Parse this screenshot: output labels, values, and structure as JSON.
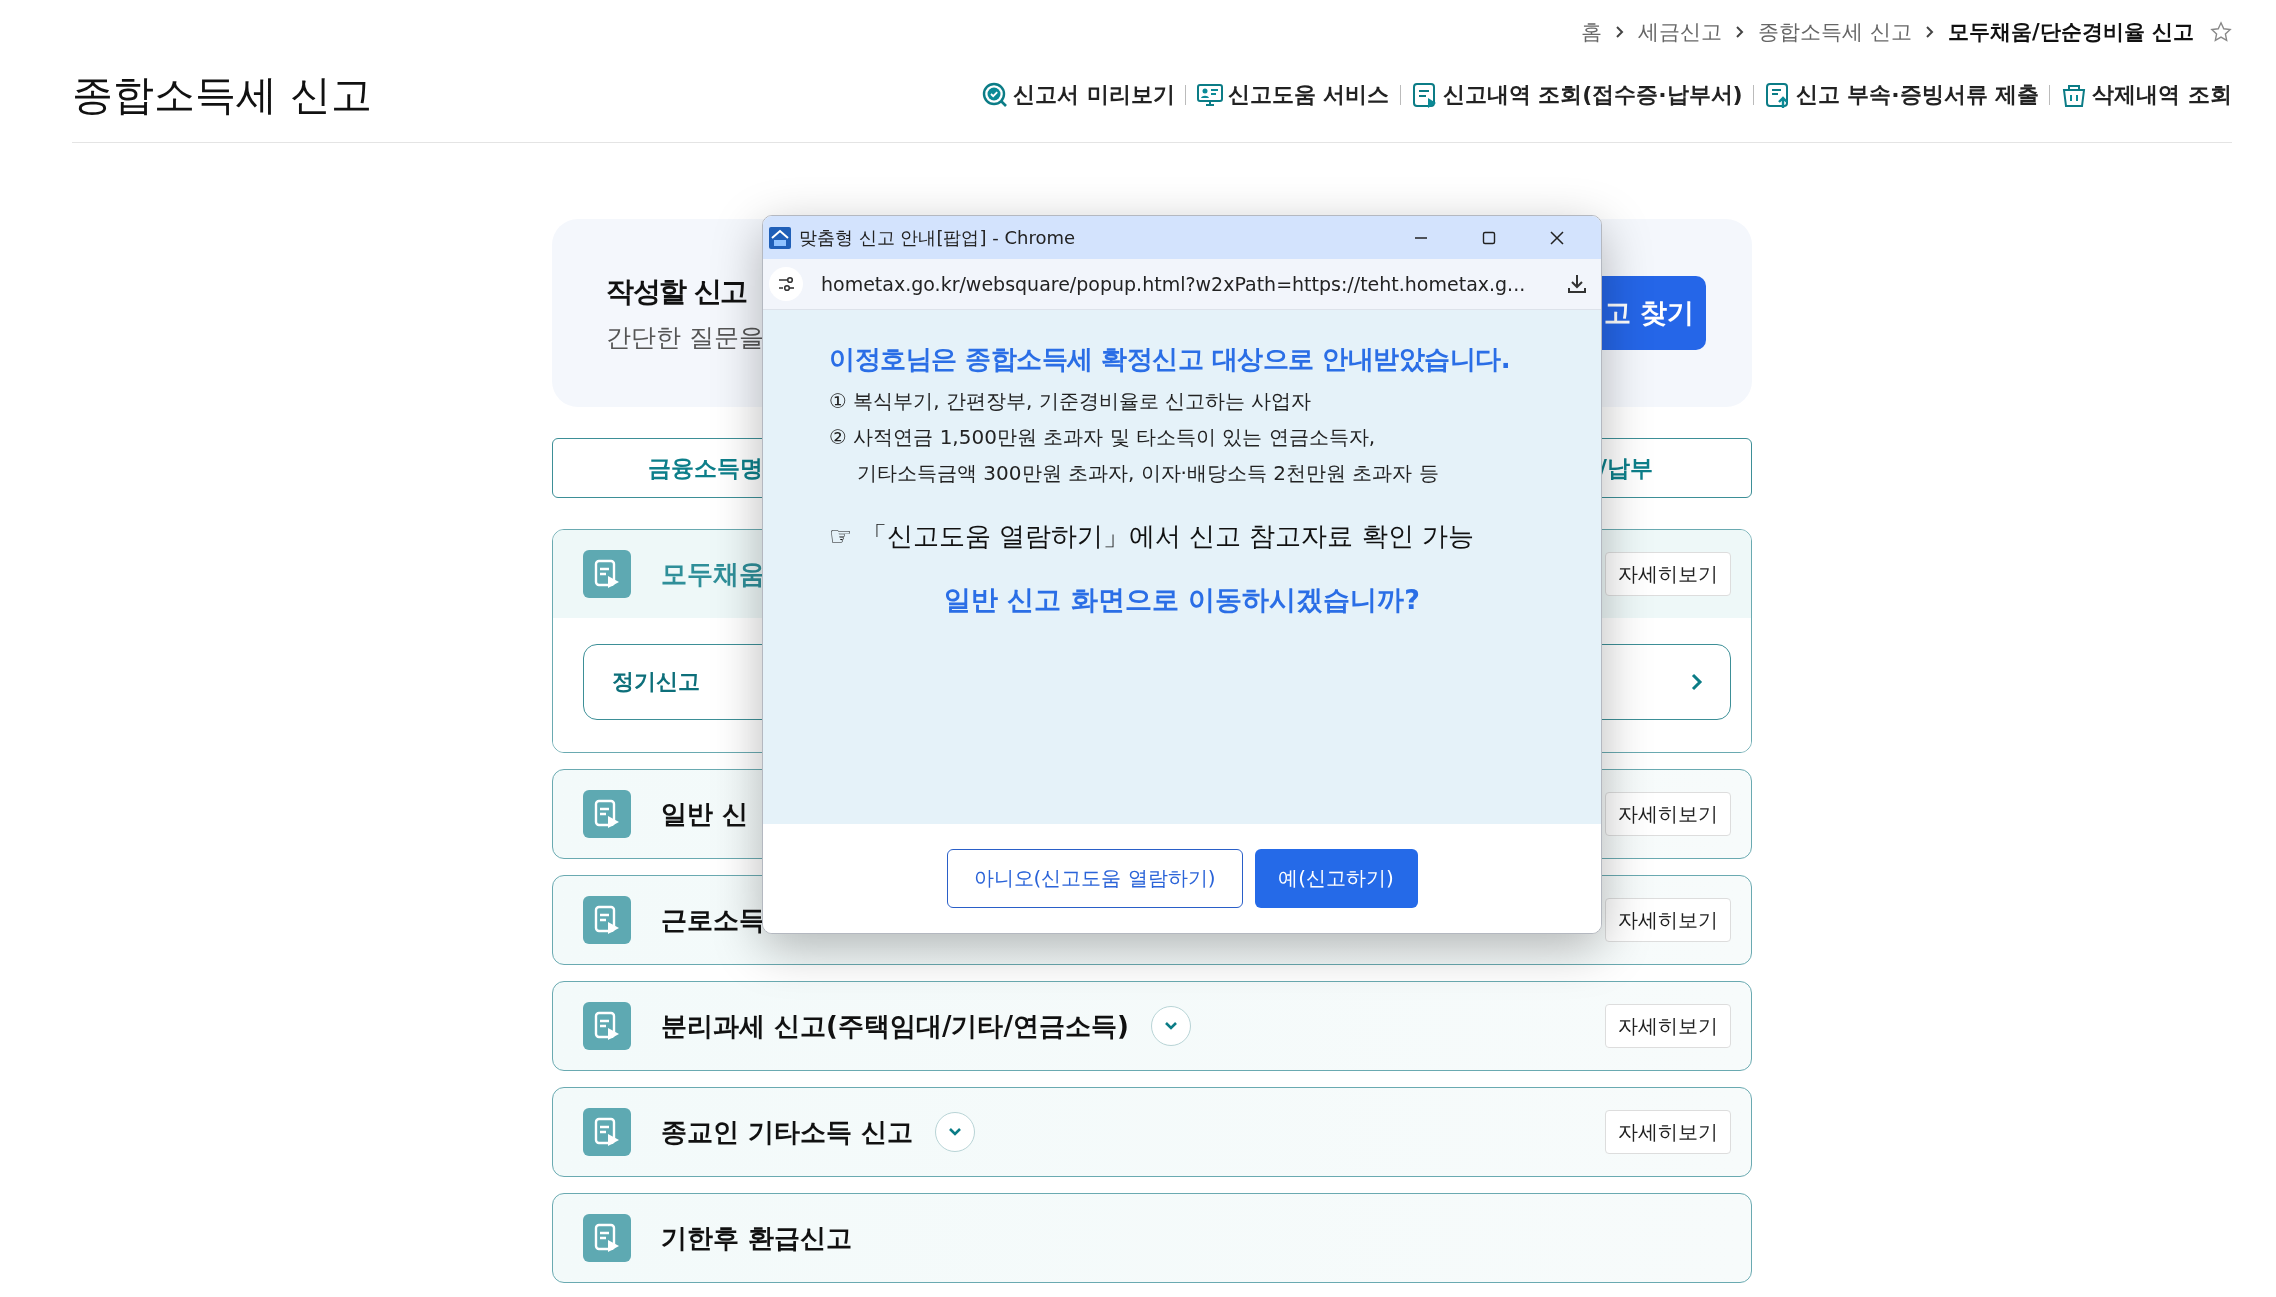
{
  "breadcrumb": {
    "items": [
      {
        "label": "홈",
        "current": false
      },
      {
        "label": "세금신고",
        "current": false
      },
      {
        "label": "종합소득세 신고",
        "current": false
      },
      {
        "label": "모두채움/단순경비율 신고",
        "current": true
      }
    ],
    "favorite": false
  },
  "page_title": "종합소득세 신고",
  "header_links": [
    {
      "label": "신고서 미리보기",
      "kind": "preview"
    },
    {
      "label": "신고도움 서비스",
      "kind": "help"
    },
    {
      "label": "신고내역 조회(접수증·납부서)",
      "kind": "history"
    },
    {
      "label": "신고 부속·증빙서류 제출",
      "kind": "upload"
    },
    {
      "label": "삭제내역 조회",
      "kind": "deleted"
    }
  ],
  "search_card": {
    "title": "작성할 신고",
    "subtitle": "간단한 질문을",
    "button": "고 찾기"
  },
  "tabs": [
    {
      "label": "금융소득명",
      "selected": false
    },
    {
      "label": "/납부",
      "selected": false
    }
  ],
  "cards": [
    {
      "title": "모두채움",
      "toggle": false,
      "details_button": "자세히보기",
      "rows": [
        {
          "label": "정기신고"
        }
      ]
    },
    {
      "title": "일반 신",
      "toggle": false,
      "details_button": "자세히보기"
    },
    {
      "title": "근로소득",
      "toggle": false,
      "details_button": "자세히보기"
    },
    {
      "title": "분리과세 신고(주택임대/기타/연금소득)",
      "toggle": true,
      "details_button": "자세히보기"
    },
    {
      "title": "종교인 기타소득 신고",
      "toggle": true,
      "details_button": "자세히보기"
    },
    {
      "title": "기한후 환급신고",
      "toggle": false
    }
  ],
  "popup": {
    "window_title": "맞춤형 신고 안내[팝업] - Chrome",
    "url": "hometax.go.kr/websquare/popup.html?w2xPath=https://teht.hometax.g...",
    "heading": "이정호님은 종합소득세 확정신고 대상으로 안내받았습니다.",
    "lines": [
      "① 복식부기, 간편장부, 기준경비율로 신고하는 사업자",
      "② 사적연금 1,500만원 초과자 및 타소득이 있는 연금소득자,",
      "기타소득금액 300만원 초과자, 이자·배당소득 2천만원 초과자 등"
    ],
    "note": "☞ 「신고도움 열람하기」에서 신고 참고자료 확인 가능",
    "question": "일반 신고 화면으로 이동하시겠습니까?",
    "buttons": [
      {
        "label": "아니오(신고도움 열람하기)",
        "kind": "secondary"
      },
      {
        "label": "예(신고하기)",
        "kind": "primary"
      }
    ]
  }
}
